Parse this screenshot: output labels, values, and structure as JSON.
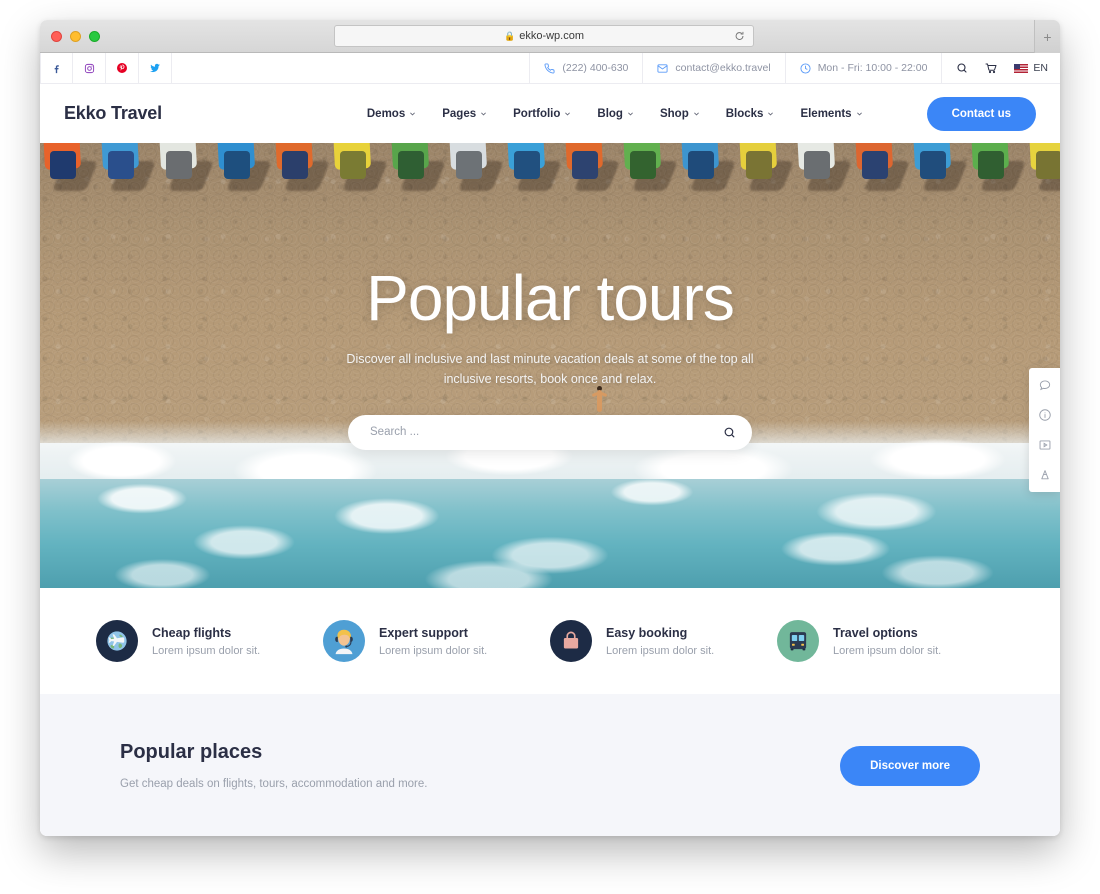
{
  "browser": {
    "url": "ekko-wp.com",
    "lock_icon": "lock-icon",
    "reload_icon": "reload-icon",
    "new_tab_icon": "plus-icon"
  },
  "topbar": {
    "social": [
      {
        "name": "facebook",
        "glyph": "f",
        "color": "#3b5998"
      },
      {
        "name": "instagram",
        "glyph": "▣",
        "color": "#8a3ab9"
      },
      {
        "name": "pinterest",
        "glyph": "P",
        "color": "#e60023"
      },
      {
        "name": "twitter",
        "glyph": "✉",
        "color": "#1da1f2"
      }
    ],
    "phone": "(222) 400-630",
    "email": "contact@ekko.travel",
    "hours": "Mon - Fri: 10:00 - 22:00",
    "language": "EN",
    "search_icon": "search-icon",
    "cart_icon": "cart-icon",
    "flag_icon": "us-flag-icon"
  },
  "header": {
    "logo": "Ekko Travel",
    "nav": [
      {
        "label": "Demos"
      },
      {
        "label": "Pages"
      },
      {
        "label": "Portfolio"
      },
      {
        "label": "Blog"
      },
      {
        "label": "Shop"
      },
      {
        "label": "Blocks"
      },
      {
        "label": "Elements"
      }
    ],
    "cta_label": "Contact us",
    "cta_color": "#3b86f7"
  },
  "hero": {
    "title": "Popular tours",
    "subtitle": "Discover all inclusive and last minute vacation deals at some of the top all inclusive resorts, book once and relax.",
    "search_placeholder": "Search ...",
    "search_value": "",
    "search_icon": "search-icon"
  },
  "side_widget": {
    "items": [
      {
        "icon": "chat-bubble-icon"
      },
      {
        "icon": "info-circle-icon"
      },
      {
        "icon": "video-play-icon"
      },
      {
        "icon": "lamp-icon"
      }
    ]
  },
  "features": [
    {
      "title": "Cheap flights",
      "desc": "Lorem ipsum dolor sit.",
      "icon": "globe-plane-icon",
      "icon_bg": "#1d2b45"
    },
    {
      "title": "Expert support",
      "desc": "Lorem ipsum dolor sit.",
      "icon": "support-agent-icon",
      "icon_bg": "#4f9fd4"
    },
    {
      "title": "Easy booking",
      "desc": "Lorem ipsum dolor sit.",
      "icon": "handbag-icon",
      "icon_bg": "#1d2b45"
    },
    {
      "title": "Travel options",
      "desc": "Lorem ipsum dolor sit.",
      "icon": "bus-icon",
      "icon_bg": "#71b79a"
    }
  ],
  "popular": {
    "title": "Popular places",
    "desc": "Get cheap deals on flights, tours, accommodation and more.",
    "button_label": "Discover more",
    "button_color": "#3b86f7"
  }
}
